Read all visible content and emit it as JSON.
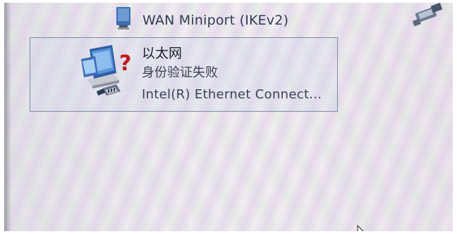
{
  "colors": {
    "text_dark": "#1c1f2a",
    "text_muted": "#3a4253",
    "selection_border": "#7d8da5",
    "error_question_mark": "#c0191f"
  },
  "connections": {
    "wan": {
      "label": "WAN Miniport (IKEv2)",
      "icon": "network-adapter-icon"
    },
    "ethernet": {
      "name": "以太网",
      "status": "身份验证失败",
      "device": "Intel(R) Ethernet Connect...",
      "icon": "network-adapter-error-icon",
      "selected": true
    },
    "partial_item_icon": "network-adapter-icon"
  },
  "cursor": "mouse-pointer-icon"
}
